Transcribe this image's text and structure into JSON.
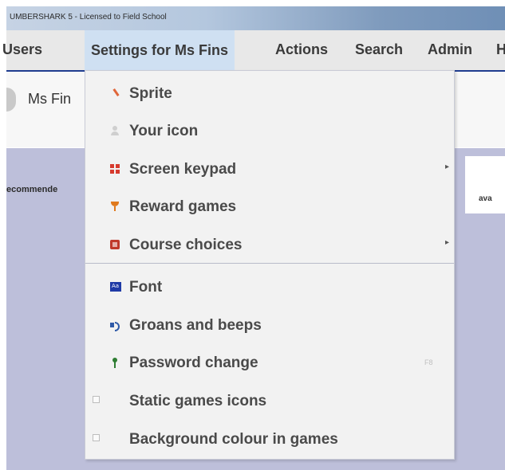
{
  "window": {
    "title": "UMBERSHARK 5   -   Licensed to Field School"
  },
  "menubar": {
    "items": [
      {
        "label": "Users"
      },
      {
        "label": "Settings for Ms Fins"
      },
      {
        "label": "Actions"
      },
      {
        "label": "Search"
      },
      {
        "label": "Admin"
      },
      {
        "label": "H"
      }
    ]
  },
  "header": {
    "user_name": "Ms Fin"
  },
  "content": {
    "recommend_text": "ecommende",
    "right_panel_text": "ava"
  },
  "dropdown": {
    "items": [
      {
        "label": "Sprite",
        "icon": "sprite-icon",
        "color": "#e0663a"
      },
      {
        "label": "Your icon",
        "icon": "user-icon",
        "color": "#cfcfcf"
      },
      {
        "label": "Screen keypad",
        "icon": "keypad-icon",
        "color": "#d63a2e",
        "has_submenu": true
      },
      {
        "label": "Reward games",
        "icon": "trophy-icon",
        "color": "#e07a1e"
      },
      {
        "label": "Course choices",
        "icon": "course-icon",
        "color": "#c0392b",
        "has_submenu": true
      },
      {
        "label": "Font",
        "icon": "font-icon",
        "color": "#1f3aa6"
      },
      {
        "label": "Groans and beeps",
        "icon": "speaker-icon",
        "color": "#2f5aa8"
      },
      {
        "label": "Password change",
        "icon": "key-icon",
        "color": "#2e7d32",
        "shortcut": "F8"
      },
      {
        "label": "Static games icons",
        "checkbox": true,
        "checked": false
      },
      {
        "label": "Background colour in games",
        "checkbox": true,
        "checked": false
      }
    ]
  },
  "colors": {
    "menubar_bg": "#e8e8e8",
    "active_menu_bg": "#cfe0f2",
    "accent_underline": "#1f3c8f",
    "lower_area_bg": "#bdbfda",
    "dropdown_bg": "#f2f2f2"
  }
}
